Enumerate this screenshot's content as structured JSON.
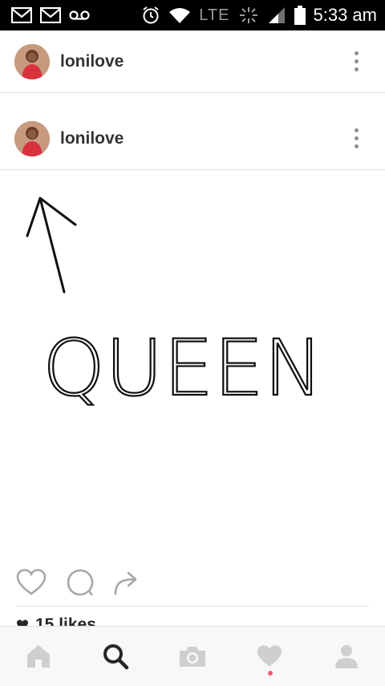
{
  "status_bar": {
    "network_label": "LTE",
    "time": "5:33 am",
    "icons": [
      "gmail-icon",
      "gmail-icon",
      "voicemail-icon",
      "alarm-icon",
      "wifi-icon",
      "signal-icon",
      "battery-icon"
    ]
  },
  "posts": [
    {
      "username": "lonilove"
    },
    {
      "username": "lonilove"
    }
  ],
  "post_image": {
    "text": "QUEEN"
  },
  "likes": {
    "label": "15 likes"
  },
  "colors": {
    "notification_dot": "#f25a6b",
    "icon_gray": "#cfcfcf",
    "active_nav": "#262626"
  }
}
